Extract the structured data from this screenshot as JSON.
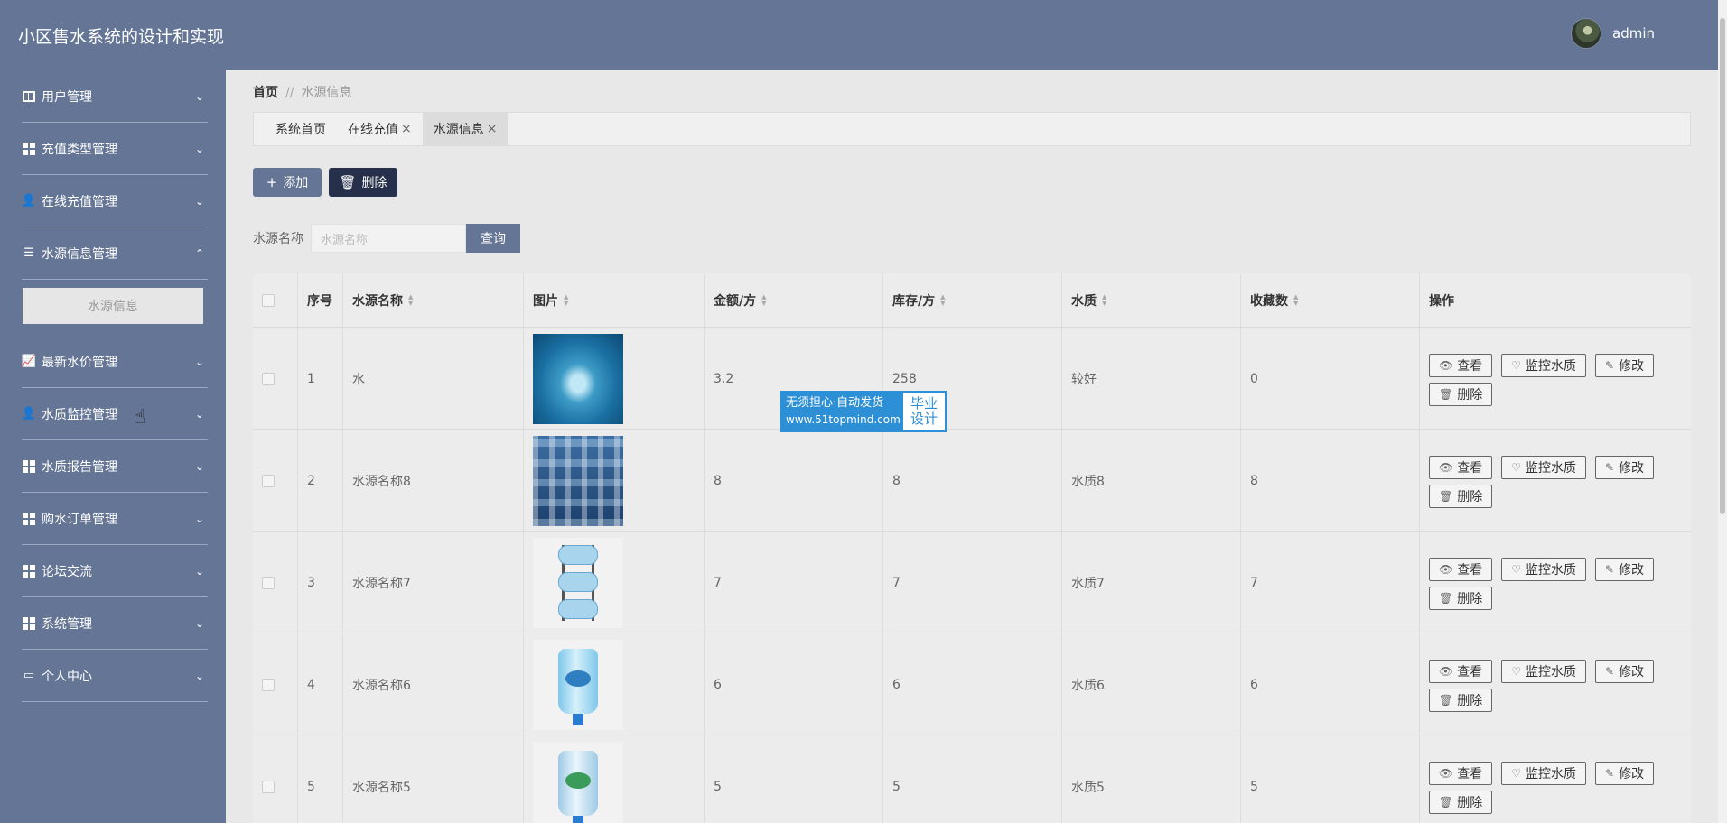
{
  "app": {
    "title": "小区售水系统的设计和实现"
  },
  "user": {
    "name": "admin"
  },
  "sidebar": {
    "items": [
      {
        "label": "用户管理",
        "icon": "table-icon",
        "expanded": false
      },
      {
        "label": "充值类型管理",
        "icon": "grid-icon",
        "expanded": false
      },
      {
        "label": "在线充值管理",
        "icon": "user-icon",
        "expanded": false
      },
      {
        "label": "水源信息管理",
        "icon": "list-icon",
        "expanded": true,
        "submenu": [
          "水源信息"
        ]
      },
      {
        "label": "最新水价管理",
        "icon": "chart-icon",
        "expanded": false
      },
      {
        "label": "水质监控管理",
        "icon": "user-icon",
        "expanded": false
      },
      {
        "label": "水质报告管理",
        "icon": "grid-icon",
        "expanded": false
      },
      {
        "label": "购水订单管理",
        "icon": "grid-icon",
        "expanded": false
      },
      {
        "label": "论坛交流",
        "icon": "grid-icon",
        "expanded": false
      },
      {
        "label": "系统管理",
        "icon": "grid-icon",
        "expanded": false
      },
      {
        "label": "个人中心",
        "icon": "card-icon",
        "expanded": false
      }
    ]
  },
  "breadcrumb": {
    "home": "首页",
    "sep": "//",
    "current": "水源信息"
  },
  "tabs": [
    {
      "label": "系统首页",
      "closable": false,
      "active": false
    },
    {
      "label": "在线充值",
      "closable": true,
      "active": false
    },
    {
      "label": "水源信息",
      "closable": true,
      "active": true
    }
  ],
  "toolbar": {
    "add_label": "添加",
    "delete_label": "删除"
  },
  "search": {
    "label": "水源名称",
    "placeholder": "水源名称",
    "button": "查询"
  },
  "table": {
    "headers": {
      "index": "序号",
      "name": "水源名称",
      "image": "图片",
      "price": "金额/方",
      "stock": "库存/方",
      "quality": "水质",
      "favorites": "收藏数",
      "actions": "操作"
    },
    "rows": [
      {
        "index": "1",
        "name": "水",
        "price": "3.2",
        "stock": "258",
        "quality": "较好",
        "favorites": "0",
        "image": "water-splash"
      },
      {
        "index": "2",
        "name": "水源名称8",
        "price": "8",
        "stock": "8",
        "quality": "水质8",
        "favorites": "8",
        "image": "bottles-crowd"
      },
      {
        "index": "3",
        "name": "水源名称7",
        "price": "7",
        "stock": "7",
        "quality": "水质7",
        "favorites": "7",
        "image": "bottle-rack"
      },
      {
        "index": "4",
        "name": "水源名称6",
        "price": "6",
        "stock": "6",
        "quality": "水质6",
        "favorites": "6",
        "image": "water-bottle"
      },
      {
        "index": "5",
        "name": "水源名称5",
        "price": "5",
        "stock": "5",
        "quality": "水质5",
        "favorites": "5",
        "image": "water-bottle"
      }
    ],
    "row_actions": {
      "view": "查看",
      "monitor": "监控水质",
      "edit": "修改",
      "delete": "删除"
    }
  },
  "watermark": {
    "line1": "无须担心·自动发货",
    "line2": "www.51topmind.com",
    "badge1": "毕业",
    "badge2": "设计"
  },
  "colors": {
    "header": "#647595",
    "sidebar": "#647595",
    "danger_button": "#26304a",
    "watermark": "#2d8fd5"
  }
}
